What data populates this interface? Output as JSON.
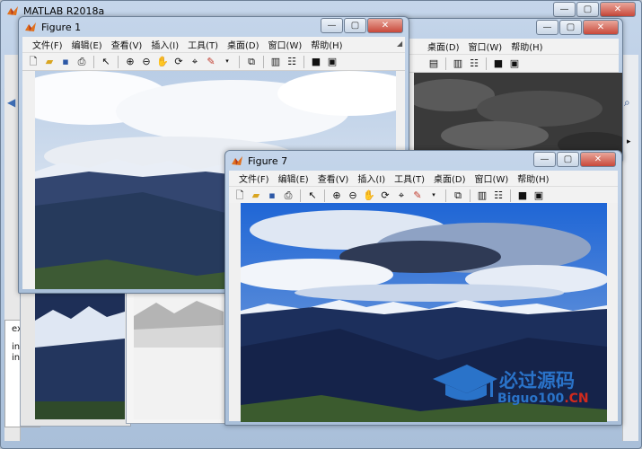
{
  "main_window": {
    "title": "MATLAB R2018a"
  },
  "figure1": {
    "title": "Figure 1",
    "menus": [
      "文件(F)",
      "编辑(E)",
      "查看(V)",
      "插入(I)",
      "工具(T)",
      "桌面(D)",
      "窗口(W)",
      "帮助(H)"
    ]
  },
  "figure_back": {
    "menus": [
      "桌面(D)",
      "窗口(W)",
      "帮助(H)"
    ]
  },
  "figure7": {
    "title": "Figure 7",
    "menus": [
      "文件(F)",
      "编辑(E)",
      "查看(V)",
      "插入(I)",
      "工具(T)",
      "桌面(D)",
      "窗口(W)",
      "帮助(H)"
    ]
  },
  "side_text": {
    "ex": "ex",
    "in1": "in",
    "in2": "in"
  },
  "watermark": {
    "brand": "必过源码",
    "domain": "Biguo100.CN"
  },
  "caption_glyphs": {
    "minimize": "—",
    "maximize": "▢",
    "close": "✕"
  },
  "colors": {
    "accent": "#3d6db4",
    "watermark_blue": "#2a73c9",
    "watermark_red": "#d12a1d"
  }
}
